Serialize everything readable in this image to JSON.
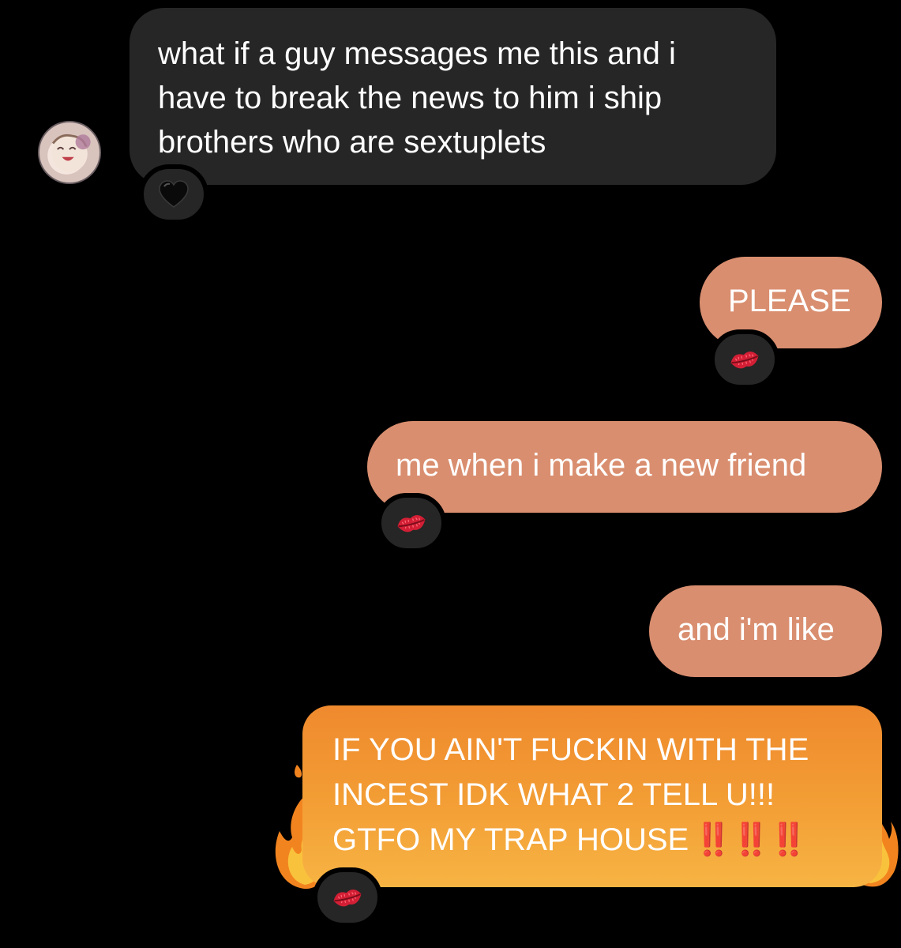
{
  "conversation": {
    "incoming": {
      "text": "what if a guy messages me this and i have to break the news to him i ship brothers who are sextuplets",
      "reaction": "black-heart-icon"
    },
    "outgoing": [
      {
        "text": "PLEASE",
        "reaction": "kiss-mark-icon"
      },
      {
        "text": "me when i make a new friend",
        "reaction": "kiss-mark-icon"
      },
      {
        "text": "and i'm like",
        "reaction": null
      }
    ],
    "fire_message": {
      "lines": [
        "IF YOU AIN'T FUCKIN WITH THE",
        "INCEST IDK WHAT 2 TELL U!!!",
        "GTFO MY TRAP HOUSE"
      ],
      "emphasis": "‼️‼️‼️",
      "effect": "fire-effect",
      "reaction": "kiss-mark-icon"
    }
  },
  "colors": {
    "background": "#000000",
    "incoming_bubble": "#262626",
    "outgoing_bubble": "#d98e6f",
    "fire_bubble_top": "#ef8a2e",
    "fire_bubble_bottom": "#f7b443",
    "text": "#ffffff",
    "emphasis": "#e0262a"
  }
}
